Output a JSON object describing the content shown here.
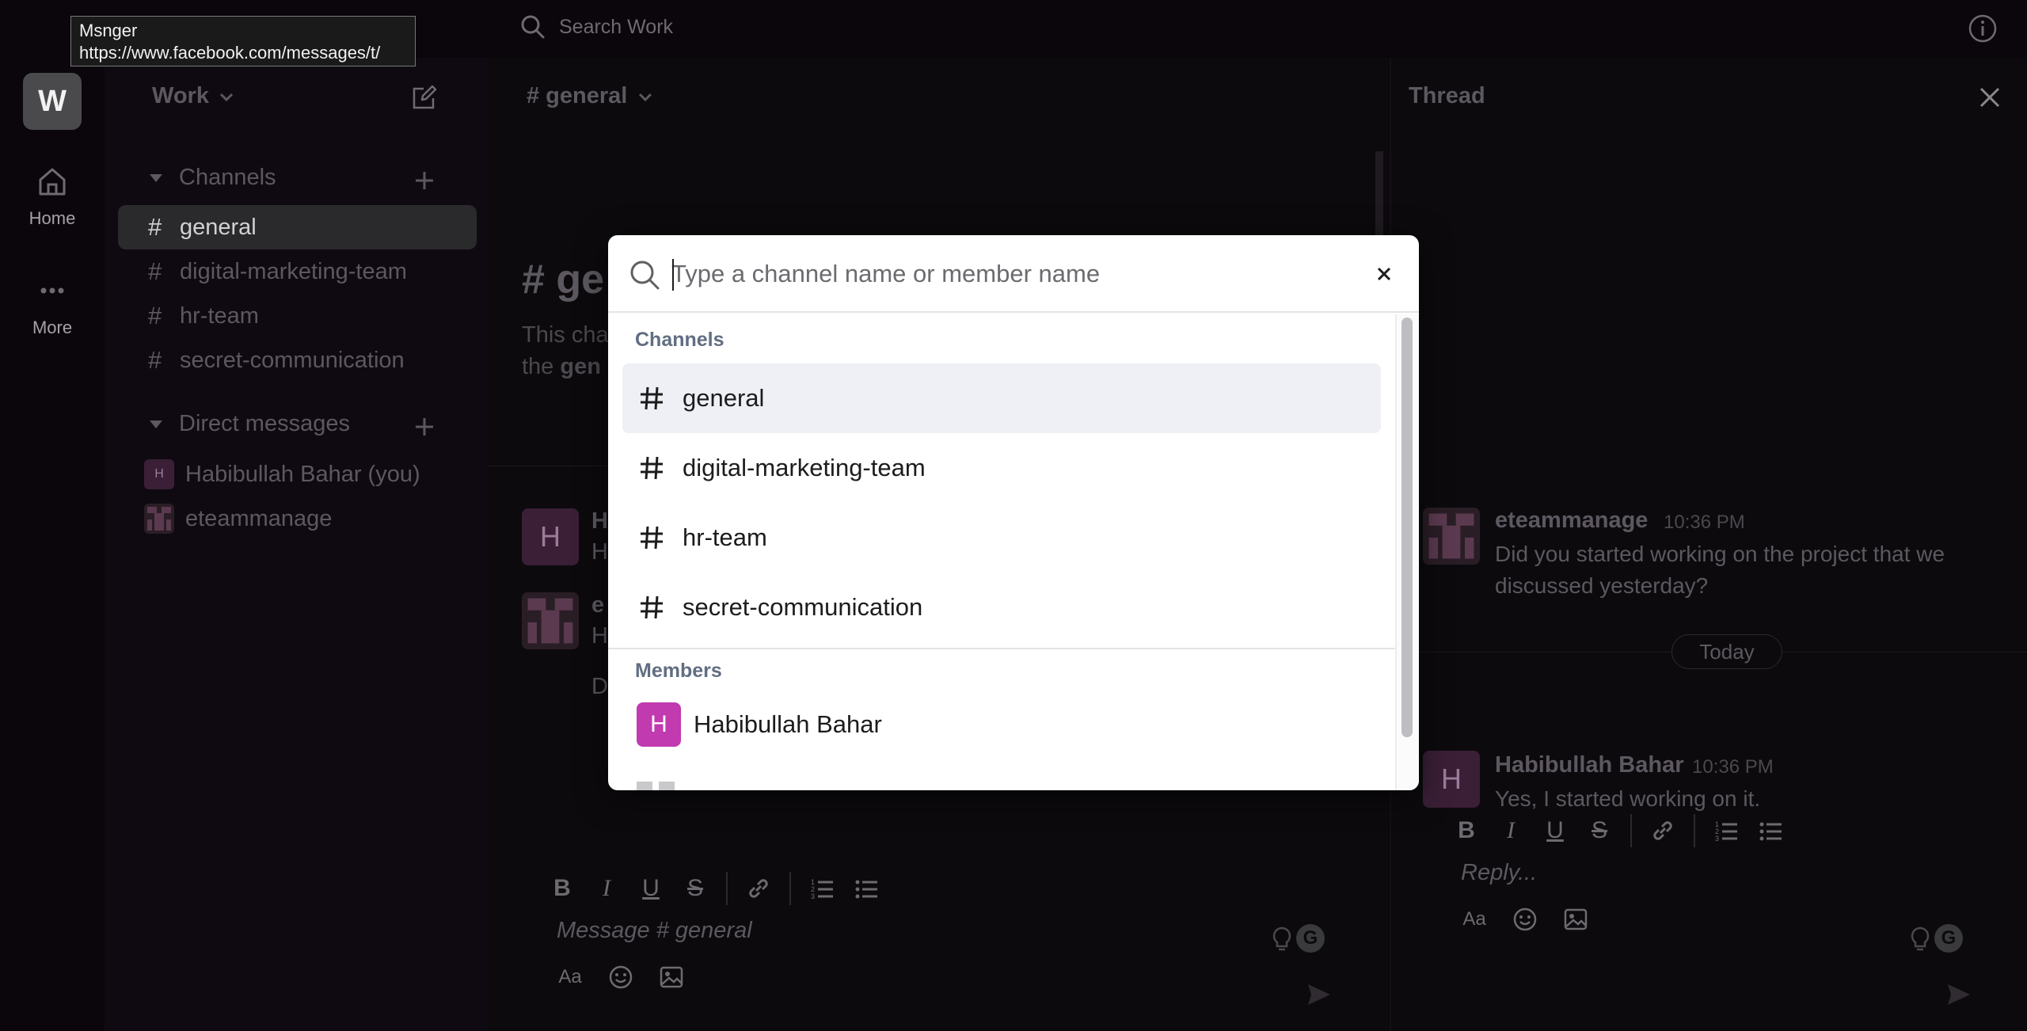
{
  "topbar": {
    "search_label": "Search Work"
  },
  "rail": {
    "workspace_initial": "W",
    "items": [
      {
        "label": "Home",
        "icon": "home-icon"
      },
      {
        "label": "More",
        "icon": "more-icon"
      }
    ]
  },
  "sidebar": {
    "workspace_name": "Work",
    "channels_header": "Channels",
    "channels": [
      "general",
      "digital-marketing-team",
      "hr-team",
      "secret-communication"
    ],
    "active_channel": "general",
    "dms_header": "Direct messages",
    "dms": [
      {
        "name": "Habibullah Bahar (you)",
        "initial": "H"
      },
      {
        "name": "eteammanage",
        "initial": ""
      }
    ]
  },
  "main": {
    "channel_title": "# general",
    "intro_title_fragment": "# ge",
    "intro_line1_fragment": "This cha",
    "intro_line2_fragment": "the ",
    "intro_line2_bold_fragment": "gen",
    "msg_author_fragment_1": "H",
    "msg_body_fragment_1": "H",
    "msg_author_fragment_2": "e",
    "msg_body_fragment_2": "H",
    "msg_fragment_3": "D",
    "composer_placeholder": "Message # general"
  },
  "thread": {
    "title": "Thread",
    "messages": [
      {
        "author": "eteammanage",
        "time": "10:36 PM",
        "text": "Did you started working on the project that we discussed yesterday?"
      },
      {
        "author": "Habibullah Bahar",
        "time": "10:36 PM",
        "text": "Yes, I started working on it."
      }
    ],
    "day_divider": "Today",
    "reply_placeholder": "Reply..."
  },
  "modal": {
    "search_placeholder": "Type a channel name or member name",
    "search_value": "",
    "channels_label": "Channels",
    "channels": [
      "general",
      "digital-marketing-team",
      "hr-team",
      "secret-communication"
    ],
    "members_label": "Members",
    "members": [
      {
        "name": "Habibullah Bahar",
        "initial": "H",
        "color": "#c13ab0"
      }
    ]
  },
  "tooltip": {
    "line1": "Msnger",
    "line2": "https://www.facebook.com/messages/t/"
  },
  "colors": {
    "member_avatar": "#c13ab0",
    "selected_row": "#eef0f5",
    "group_label": "#616e82"
  }
}
